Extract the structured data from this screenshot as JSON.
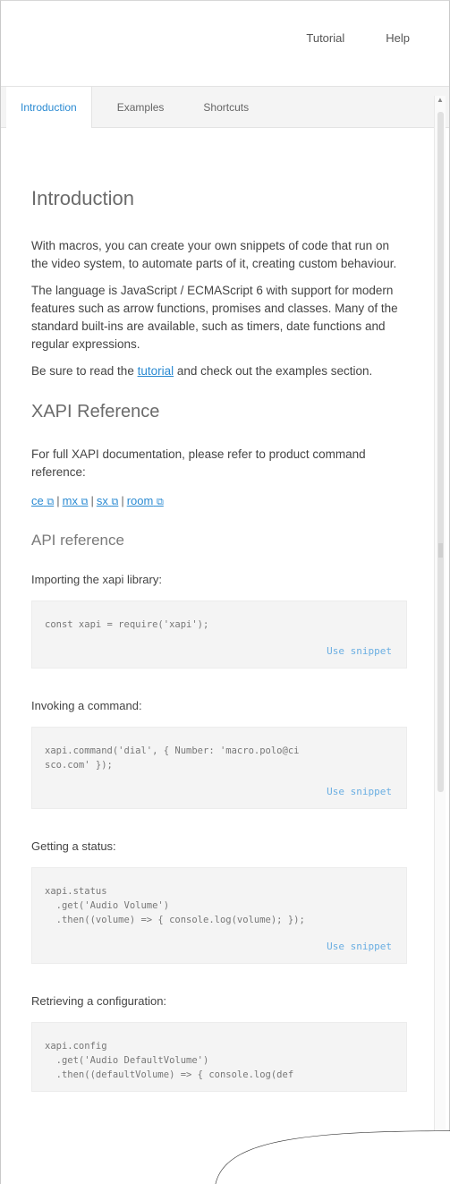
{
  "topnav": {
    "tutorial": "Tutorial",
    "help": "Help"
  },
  "tabs": [
    {
      "label": "Introduction",
      "active": true
    },
    {
      "label": "Examples",
      "active": false
    },
    {
      "label": "Shortcuts",
      "active": false
    }
  ],
  "intro": {
    "title": "Introduction",
    "p1": "With macros, you can create your own snippets of code that run on the video system, to automate parts of it, creating custom behaviour.",
    "p2": "The language is JavaScript / ECMAScript 6 with support for modern features such as arrow functions, promises and classes. Many of the standard built-ins are available, such as timers, date functions and regular expressions.",
    "p3_before": "Be sure to read the ",
    "p3_link": "tutorial",
    "p3_after": " and check out the examples section."
  },
  "xapi": {
    "title": "XAPI Reference",
    "text": "For full XAPI documentation, please refer to product command reference:",
    "refs": [
      "ce",
      "mx",
      "sx",
      "room"
    ],
    "ext_icon": "external-link-icon"
  },
  "api": {
    "title": "API reference",
    "snippets": [
      {
        "label": "Importing the xapi library:",
        "code": [
          "const xapi = require('xapi');"
        ],
        "use": "Use snippet"
      },
      {
        "label": "Invoking a command:",
        "code": [
          "xapi.command('dial', { Number: 'macro.polo@ci",
          "sco.com' });"
        ],
        "use": "Use snippet"
      },
      {
        "label": "Getting a status:",
        "code": [
          "xapi.status",
          "  .get('Audio Volume')",
          "  .then((volume) => { console.log(volume); });"
        ],
        "use": "Use snippet"
      },
      {
        "label": "Retrieving a configuration:",
        "code": [
          "xapi.config",
          "  .get('Audio DefaultVolume')",
          "  .then((defaultVolume) => { console.log(def"
        ],
        "use": ""
      }
    ]
  }
}
